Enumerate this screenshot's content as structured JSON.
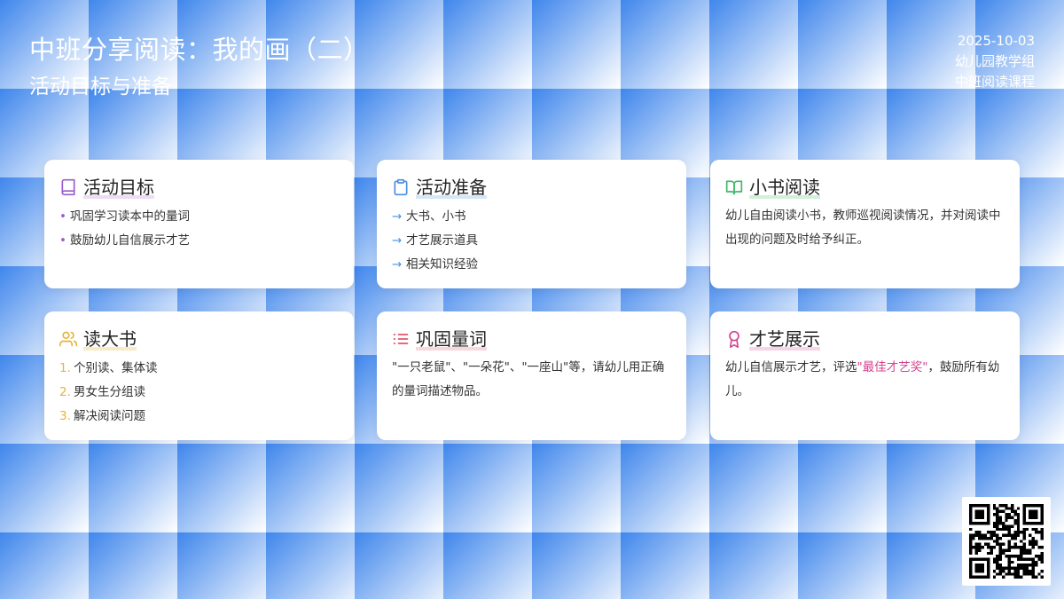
{
  "header": {
    "title": "中班分享阅读：我的画（二）",
    "subtitle": "活动目标与准备",
    "date": "2025-10-03",
    "org": "幼儿园教学组",
    "course": "中班阅读课程"
  },
  "colors": {
    "purple": "#9b59d0",
    "blue": "#4a8fe0",
    "green": "#3fb86a",
    "yellow": "#e8b43a",
    "red": "#e2566c",
    "pink": "#d6448d"
  },
  "cards": [
    {
      "icon": "book-icon",
      "title": "活动目标",
      "marker": "•",
      "items": [
        "巩固学习读本中的量词",
        "鼓励幼儿自信展示才艺"
      ]
    },
    {
      "icon": "clipboard-icon",
      "title": "活动准备",
      "marker": "→",
      "items": [
        "大书、小书",
        "才艺展示道具",
        "相关知识经验"
      ]
    },
    {
      "icon": "book-open-icon",
      "title": "小书阅读",
      "text": "幼儿自由阅读小书，教师巡视阅读情况，并对阅读中出现的问题及时给予纠正。"
    },
    {
      "icon": "users-icon",
      "title": "读大书",
      "items": [
        "个别读、集体读",
        "男女生分组读",
        "解决阅读问题"
      ],
      "markers": [
        "1.",
        "2.",
        "3."
      ]
    },
    {
      "icon": "list-icon",
      "title": "巩固量词",
      "text": "\"一只老鼠\"、\"一朵花\"、\"一座山\"等，请幼儿用正确的量词描述物品。"
    },
    {
      "icon": "award-icon",
      "title": "才艺展示",
      "text_before": "幼儿自信展示才艺，评选",
      "text_highlight": "\"最佳才艺奖\"",
      "text_after": "，鼓励所有幼儿。"
    }
  ],
  "qr": {
    "icon": "qr-code-icon"
  }
}
